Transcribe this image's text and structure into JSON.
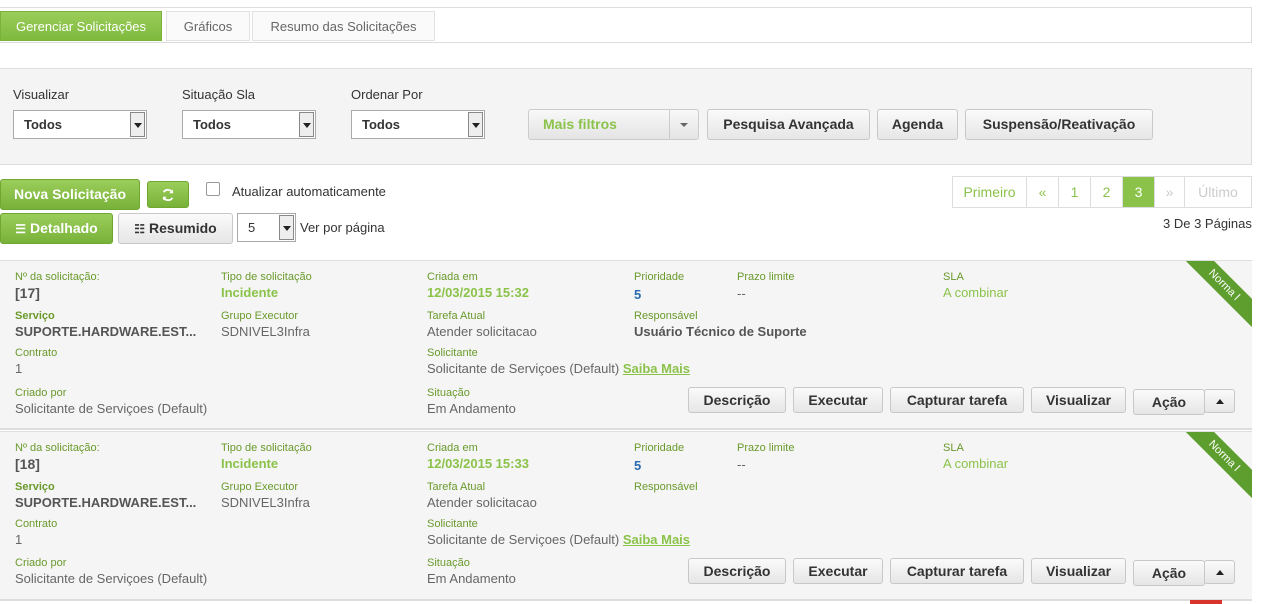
{
  "tabs": [
    "Gerenciar Solicitações",
    "Gráficos",
    "Resumo das Solicitações"
  ],
  "filters": {
    "visualizar": {
      "label": "Visualizar",
      "value": "Todos"
    },
    "situacao_sla": {
      "label": "Situação Sla",
      "value": "Todos"
    },
    "ordenar_por": {
      "label": "Ordenar Por",
      "value": "Todos"
    },
    "mais_filtros": "Mais filtros",
    "pesquisa_avancada": "Pesquisa Avançada",
    "agenda": "Agenda",
    "suspensao": "Suspensão/Reativação"
  },
  "toolbar": {
    "nova": "Nova Solicitação",
    "auto_update": "Atualizar automaticamente",
    "detalhado": "Detalhado",
    "resumido": "Resumido",
    "per_page": "5",
    "per_page_label": "Ver por página",
    "pages_info": "3 De 3 Páginas"
  },
  "pager": {
    "primeiro": "Primeiro",
    "prev": "«",
    "p1": "1",
    "p2": "2",
    "p3": "3",
    "next": "»",
    "ultimo": "Último"
  },
  "labels": {
    "numero": "Nº da solicitação:",
    "tipo": "Tipo de solicitação",
    "criada": "Criada em",
    "prioridade": "Prioridade",
    "prazo": "Prazo limite",
    "sla": "SLA",
    "servico": "Serviço",
    "grupo": "Grupo Executor",
    "tarefa": "Tarefa Atual",
    "responsavel": "Responsável",
    "contrato": "Contrato",
    "solicitante": "Solicitante",
    "criado_por": "Criado por",
    "situacao": "Situação",
    "saiba_mais": "Saiba Mais",
    "descricao": "Descrição",
    "executar": "Executar",
    "capturar": "Capturar tarefa",
    "visualizar": "Visualizar",
    "acao": "Ação"
  },
  "cards": [
    {
      "numero": "[17]",
      "tipo": "Incidente",
      "criada": "12/03/2015 15:32",
      "prioridade": "5",
      "prazo": "--",
      "sla": "A combinar",
      "servico": "SUPORTE.HARDWARE.EST...",
      "grupo": "SDNIVEL3Infra",
      "tarefa": "Atender solicitacao",
      "responsavel": "Usuário Técnico de Suporte",
      "contrato": "1",
      "solicitante": "Solicitante de Serviçoes (Default)",
      "criado_por": "Solicitante de Serviçoes (Default)",
      "situacao": "Em Andamento",
      "ribbon": "Norma l"
    },
    {
      "numero": "[18]",
      "tipo": "Incidente",
      "criada": "12/03/2015 15:33",
      "prioridade": "5",
      "prazo": "--",
      "sla": "A combinar",
      "servico": "SUPORTE.HARDWARE.EST...",
      "grupo": "SDNIVEL3Infra",
      "tarefa": "Atender solicitacao",
      "responsavel": "",
      "contrato": "1",
      "solicitante": "Solicitante de Serviçoes (Default)",
      "criado_por": "Solicitante de Serviçoes (Default)",
      "situacao": "Em Andamento",
      "ribbon": "Norma l"
    }
  ]
}
